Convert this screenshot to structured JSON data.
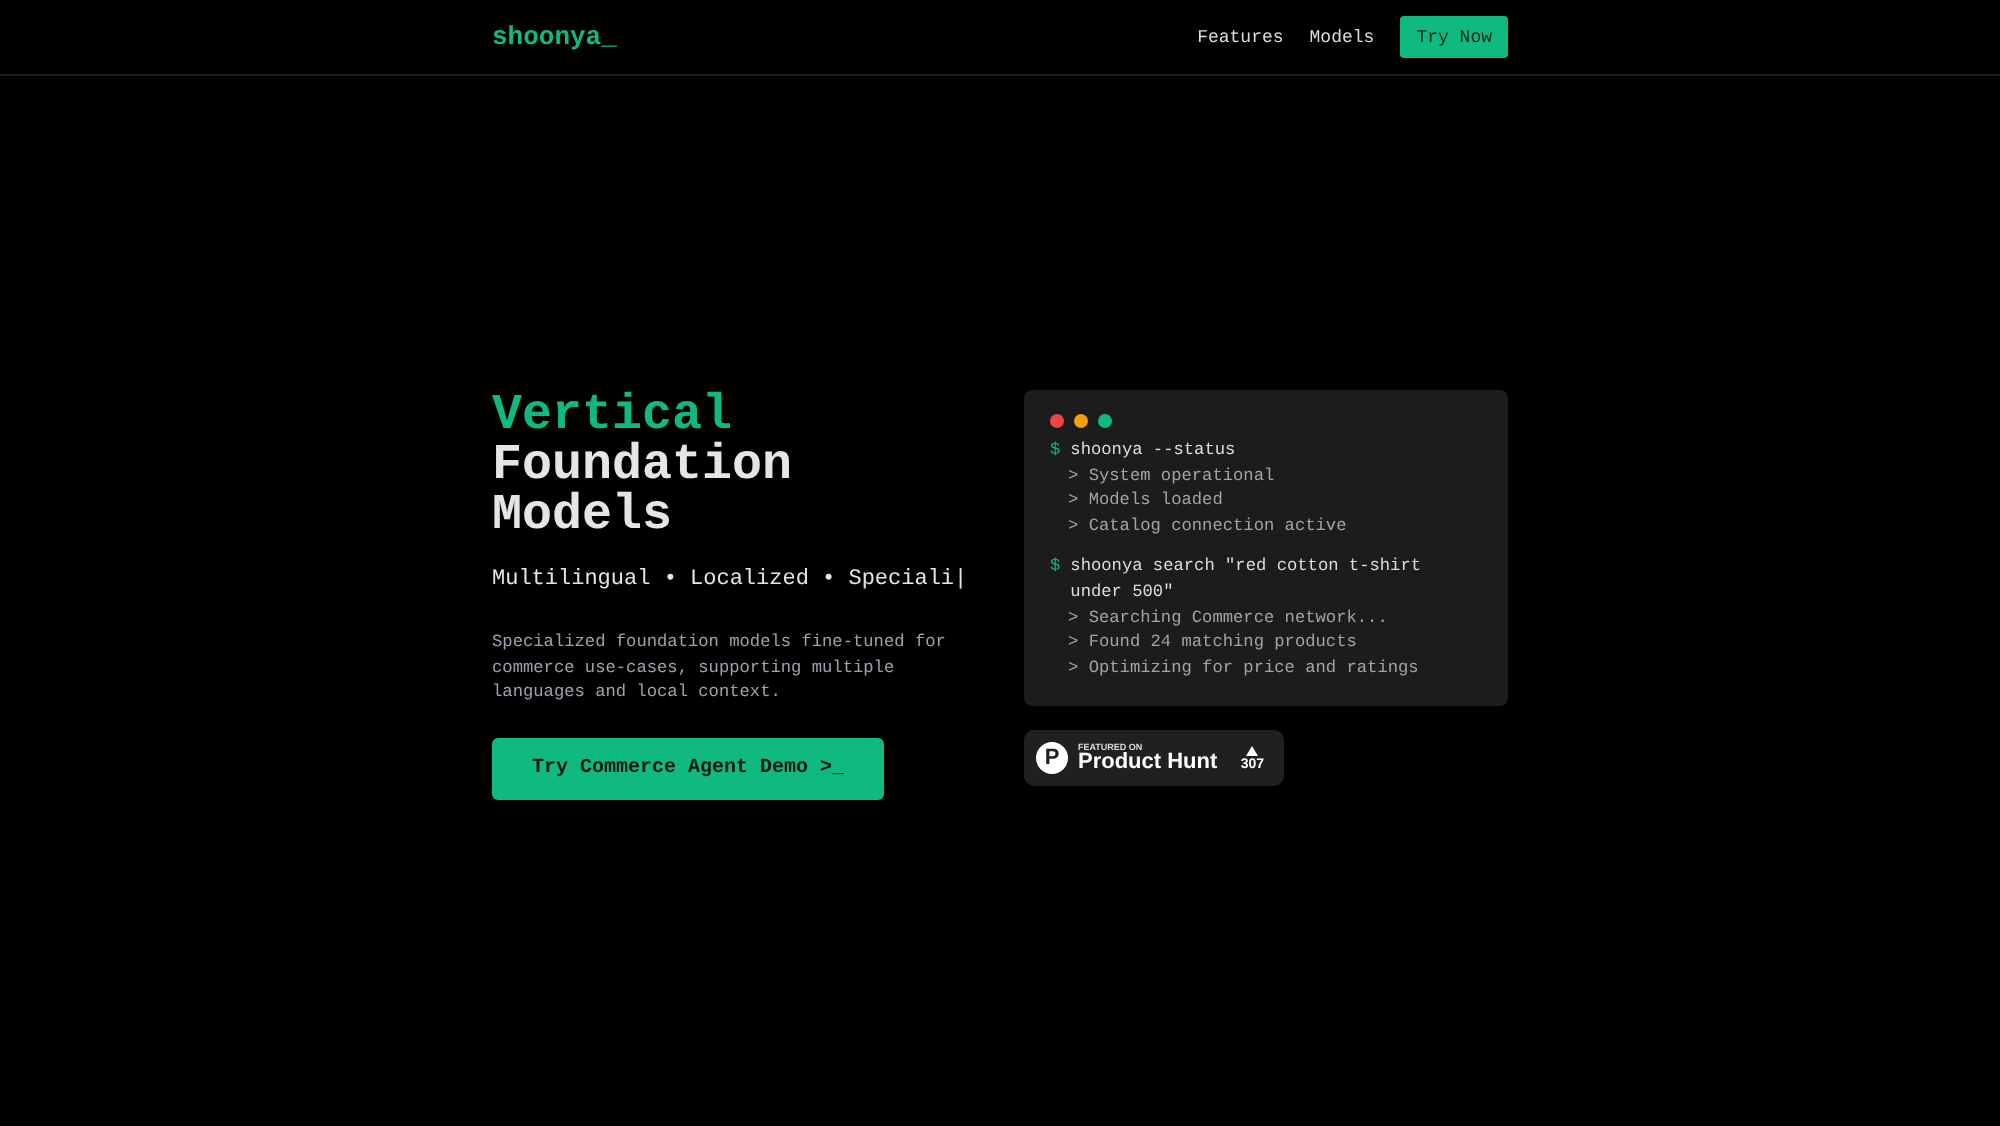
{
  "nav": {
    "logo": "shoonya_",
    "links": [
      {
        "label": "Features"
      },
      {
        "label": "Models"
      }
    ],
    "cta": "Try Now"
  },
  "hero": {
    "title_accent": "Vertical",
    "title_lines": [
      "Foundation",
      "Models"
    ],
    "tagline": "Multilingual • Localized • Speciali|",
    "description": "Specialized foundation models fine-tuned for commerce use-cases, supporting multiple languages and local context.",
    "button": "Try Commerce Agent Demo >_"
  },
  "terminal": {
    "dots": [
      {
        "color": "#ef4444"
      },
      {
        "color": "#f59e0b"
      },
      {
        "color": "#10b981"
      }
    ],
    "blocks": [
      {
        "prompt": "$",
        "command": "shoonya --status",
        "outputs": [
          "> System operational",
          "> Models loaded",
          "> Catalog connection active"
        ]
      },
      {
        "prompt": "$",
        "command": "shoonya search \"red cotton t-shirt under 500\"",
        "outputs": [
          "> Searching Commerce network...",
          "> Found 24 matching products",
          "> Optimizing for price and ratings"
        ]
      }
    ]
  },
  "badge": {
    "logo_letter": "P",
    "eyebrow": "FEATURED ON",
    "name": "Product Hunt",
    "votes": "307"
  }
}
